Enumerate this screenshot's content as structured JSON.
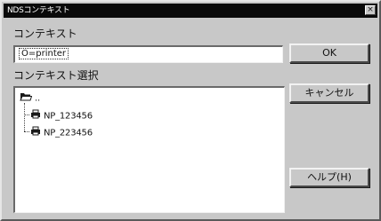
{
  "window": {
    "title": "NDSコンテキスト",
    "close_label": "×"
  },
  "context": {
    "label": "コンテキスト",
    "value": "O=printer"
  },
  "browse": {
    "label": "コンテキスト選択",
    "root": {
      "label": "..",
      "icon": "folder-icon"
    },
    "children": [
      {
        "label": "NP_123456",
        "icon": "printer-icon"
      },
      {
        "label": "NP_223456",
        "icon": "printer-icon"
      }
    ]
  },
  "buttons": {
    "ok": "OK",
    "cancel": "キャンセル",
    "help": "ヘルプ(H)"
  }
}
